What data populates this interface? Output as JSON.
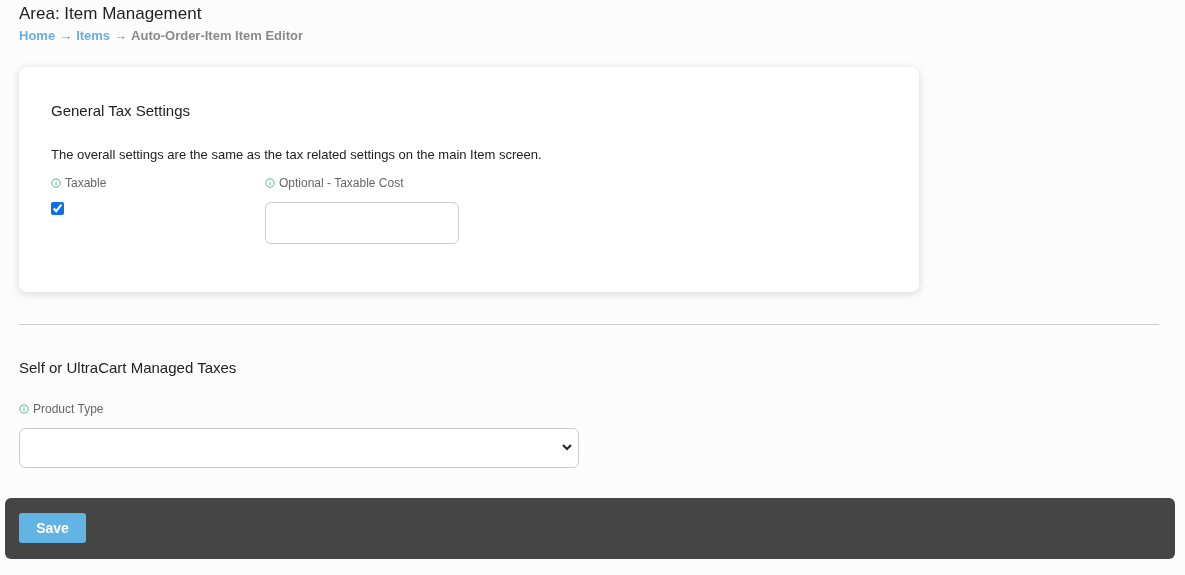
{
  "header": {
    "title": "Area: Item Management"
  },
  "breadcrumb": [
    {
      "kind": "link",
      "label": "Home"
    },
    {
      "kind": "separator",
      "label": "→"
    },
    {
      "kind": "link",
      "label": "Items"
    },
    {
      "kind": "separator",
      "label": "→"
    },
    {
      "kind": "current",
      "label": "Auto-Order-Item Item Editor"
    }
  ],
  "general_tax": {
    "title": "General Tax Settings",
    "description": "The overall settings are the same as the tax related settings on the main Item screen.",
    "taxable": {
      "label": "Taxable",
      "checked": true
    },
    "taxable_cost": {
      "label": "Optional - Taxable Cost"
    }
  },
  "managed_taxes": {
    "title": "Self or UltraCart Managed Taxes",
    "product_type": {
      "label": "Product Type"
    }
  },
  "footer": {
    "save_button": "Save"
  }
}
